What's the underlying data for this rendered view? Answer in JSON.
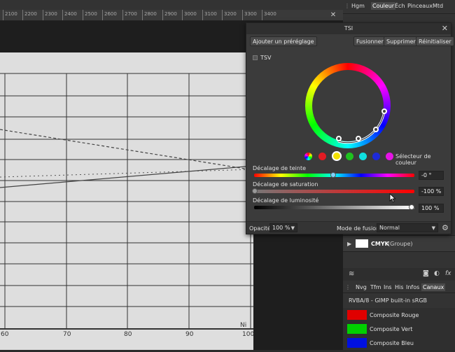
{
  "ruler": {
    "ticks": [
      "2100",
      "2200",
      "2300",
      "2400",
      "2500",
      "2600",
      "2700",
      "2800",
      "2900",
      "3000",
      "3100",
      "3200",
      "3300",
      "3400"
    ]
  },
  "right_tabs": [
    "Hgm",
    "Couleur",
    "Éch",
    "Pinceaux",
    "Mtd"
  ],
  "dialog": {
    "title": "TSI",
    "add_preset": "Ajouter un préréglage",
    "merge": "Fusionner",
    "delete": "Supprimer",
    "reset": "Réinitialiser",
    "tsv_label": "TSV",
    "color_picker": "Sélecteur de couleur",
    "hue_label": "Décalage de teinte",
    "hue_value": "-0 °",
    "sat_label": "Décalage de saturation",
    "sat_value": "-100 %",
    "lum_label": "Décalage de luminosité",
    "lum_value": "100 %",
    "opacity_label": "Opacité:",
    "opacity_value": "100 %",
    "blend_label": "Mode de fusion:",
    "blend_value": "Normal",
    "swatch_colors": [
      "#e31b23",
      "#f2e000",
      "#1fc21f",
      "#10e0e0",
      "#1d2ad8",
      "#e514e5"
    ]
  },
  "layers": {
    "group_name": "CMYK",
    "group_tag": "(Groupe)"
  },
  "channels_tabs": [
    "Nvg",
    "Tfm",
    "Ins",
    "His",
    "Infos",
    "Canaux"
  ],
  "channels": {
    "profile": "RVBA/8 - GIMP built-in sRGB",
    "items": [
      {
        "label": "Composite Rouge",
        "color": "#e00000"
      },
      {
        "label": "Composite Vert",
        "color": "#00d000"
      },
      {
        "label": "Composite Bleu",
        "color": "#0010e0"
      }
    ]
  },
  "paper_labels": {
    "x60": "60",
    "x70": "70",
    "x80": "80",
    "x90": "90",
    "x100": "100",
    "ni": "Ni"
  }
}
